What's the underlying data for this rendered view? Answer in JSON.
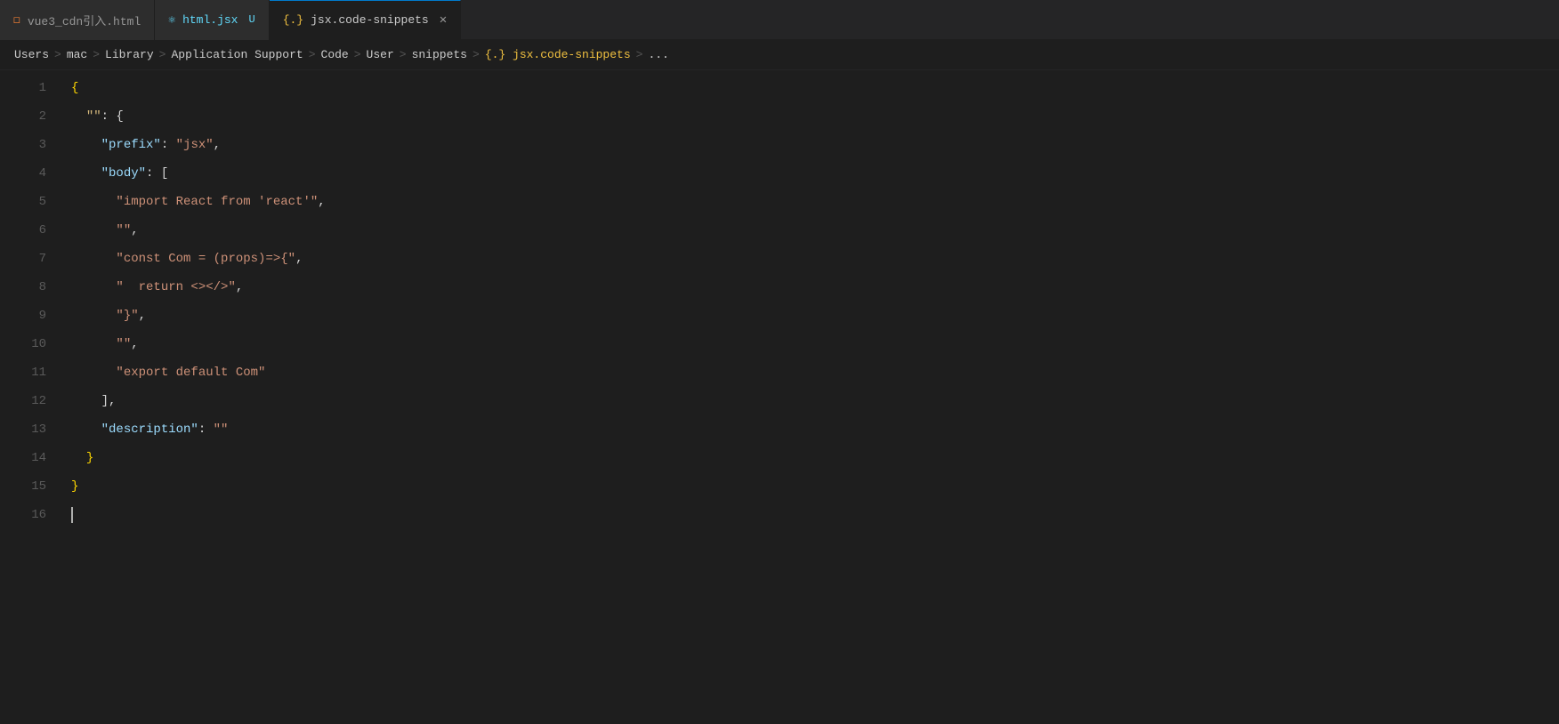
{
  "tabs": [
    {
      "id": "tab-html",
      "icon": "html-icon",
      "icon_char": "◻",
      "icon_color": "#e37933",
      "label": "vue3_cdn引入.html",
      "modified": false,
      "active": false,
      "show_close": false
    },
    {
      "id": "tab-jsx",
      "icon": "react-icon",
      "icon_char": "⚛",
      "icon_color": "#61dafb",
      "label": "html.jsx",
      "modified_badge": "U",
      "modified": true,
      "active": false,
      "show_close": false
    },
    {
      "id": "tab-snippets",
      "icon": "snippet-icon",
      "icon_char": "{.}",
      "icon_color": "#f0c040",
      "label": "jsx.code-snippets",
      "modified": false,
      "active": true,
      "show_close": true
    }
  ],
  "breadcrumb": {
    "items": [
      "Users",
      "mac",
      "Library",
      "Application Support",
      "Code",
      "User",
      "snippets",
      "{.} jsx.code-snippets",
      "..."
    ],
    "separator": ">"
  },
  "lines": [
    {
      "num": 1,
      "tokens": [
        {
          "text": "{",
          "class": "c-brace"
        }
      ]
    },
    {
      "num": 2,
      "tokens": [
        {
          "text": "  ",
          "class": "c-default"
        },
        {
          "text": "\"\"",
          "class": "c-string-yellow"
        },
        {
          "text": ": {",
          "class": "c-default"
        }
      ]
    },
    {
      "num": 3,
      "tokens": [
        {
          "text": "    ",
          "class": "c-default"
        },
        {
          "text": "\"prefix\"",
          "class": "c-key"
        },
        {
          "text": ": ",
          "class": "c-default"
        },
        {
          "text": "\"jsx\"",
          "class": "c-string"
        },
        {
          "text": ",",
          "class": "c-default"
        }
      ]
    },
    {
      "num": 4,
      "tokens": [
        {
          "text": "    ",
          "class": "c-default"
        },
        {
          "text": "\"body\"",
          "class": "c-key"
        },
        {
          "text": ": [",
          "class": "c-default"
        }
      ]
    },
    {
      "num": 5,
      "tokens": [
        {
          "text": "      ",
          "class": "c-default"
        },
        {
          "text": "\"import React from 'react'\"",
          "class": "c-string"
        },
        {
          "text": ",",
          "class": "c-default"
        }
      ]
    },
    {
      "num": 6,
      "tokens": [
        {
          "text": "      ",
          "class": "c-default"
        },
        {
          "text": "\"\"",
          "class": "c-string"
        },
        {
          "text": ",",
          "class": "c-default"
        }
      ]
    },
    {
      "num": 7,
      "tokens": [
        {
          "text": "      ",
          "class": "c-default"
        },
        {
          "text": "\"const Com = (props)=>{\"",
          "class": "c-string"
        },
        {
          "text": ",",
          "class": "c-default"
        }
      ]
    },
    {
      "num": 8,
      "tokens": [
        {
          "text": "      ",
          "class": "c-default"
        },
        {
          "text": "\"  return <></>\"",
          "class": "c-string"
        },
        {
          "text": ",",
          "class": "c-default"
        }
      ]
    },
    {
      "num": 9,
      "tokens": [
        {
          "text": "      ",
          "class": "c-default"
        },
        {
          "text": "\"}\"",
          "class": "c-string"
        },
        {
          "text": ",",
          "class": "c-default"
        }
      ]
    },
    {
      "num": 10,
      "tokens": [
        {
          "text": "      ",
          "class": "c-default"
        },
        {
          "text": "\"\"",
          "class": "c-string"
        },
        {
          "text": ",",
          "class": "c-default"
        }
      ]
    },
    {
      "num": 11,
      "tokens": [
        {
          "text": "      ",
          "class": "c-default"
        },
        {
          "text": "\"export default Com\"",
          "class": "c-string"
        }
      ]
    },
    {
      "num": 12,
      "tokens": [
        {
          "text": "    ",
          "class": "c-default"
        },
        {
          "text": "],",
          "class": "c-default"
        }
      ]
    },
    {
      "num": 13,
      "tokens": [
        {
          "text": "    ",
          "class": "c-default"
        },
        {
          "text": "\"description\"",
          "class": "c-key"
        },
        {
          "text": ": ",
          "class": "c-default"
        },
        {
          "text": "\"\"",
          "class": "c-string"
        }
      ]
    },
    {
      "num": 14,
      "tokens": [
        {
          "text": "  ",
          "class": "c-default"
        },
        {
          "text": "}",
          "class": "c-brace"
        }
      ]
    },
    {
      "num": 15,
      "tokens": [
        {
          "text": "}",
          "class": "c-brace"
        }
      ]
    },
    {
      "num": 16,
      "tokens": [],
      "cursor": true
    }
  ]
}
